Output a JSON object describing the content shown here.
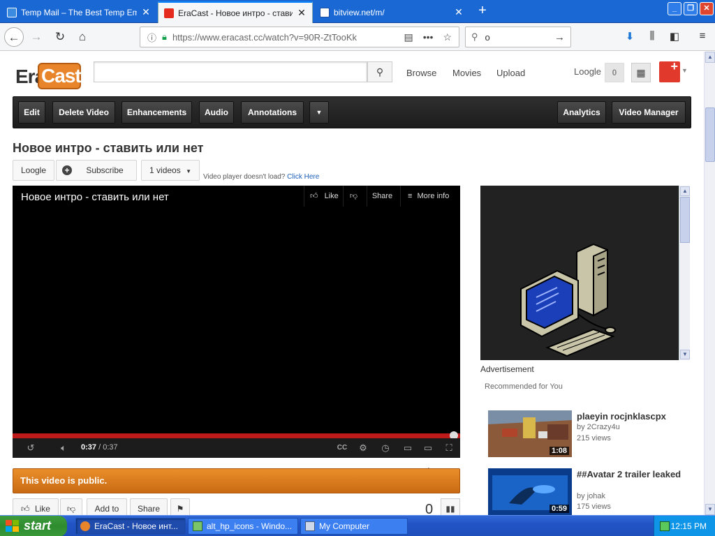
{
  "browser": {
    "tabs": [
      {
        "label": "Temp Mail – The Best Temp Email I",
        "active": false
      },
      {
        "label": "EraCast - Новое интро - ставить",
        "active": true
      },
      {
        "label": "bitview.net/m/",
        "active": false
      }
    ],
    "url": "https://www.eracast.cc/watch?v=90R-ZtTooKk",
    "search_text": "o"
  },
  "header": {
    "logo_era": "Era",
    "logo_cast": "Cast",
    "nav": [
      "Browse",
      "Movies",
      "Upload"
    ],
    "username": "Loogle",
    "notifications": "0"
  },
  "actionbar": {
    "left": [
      "Edit",
      "Delete Video",
      "Enhancements",
      "Audio",
      "Annotations"
    ],
    "right": [
      "Analytics",
      "Video Manager"
    ]
  },
  "video": {
    "title": "Новое интро - ставить или нет",
    "channel": "Loogle",
    "subscribe": "Subscribe",
    "videos_count": "1 videos",
    "load_msg": "Video player doesn't load?",
    "load_link": "Click Here",
    "player_actions": {
      "like": "Like",
      "share": "Share",
      "more": "More info"
    },
    "time_current": "0:37",
    "time_total": "/ 0:37",
    "progress": 1.0,
    "public_msg": "This video is public.",
    "bottom_buttons": {
      "like": "Like",
      "add": "Add to",
      "share": "Share"
    },
    "views": "0"
  },
  "sidebar": {
    "ad_label": "Advertisement",
    "recommended_label": "Recommended for You",
    "recommended": [
      {
        "title": "plaeyin rocjnklascpx",
        "by": "by 2Crazy4u",
        "views": "215 views",
        "duration": "1:08"
      },
      {
        "title": "##Avatar 2 trailer leaked",
        "by": "by johak",
        "views": "175 views",
        "duration": "0:59"
      }
    ]
  },
  "taskbar": {
    "start": "start",
    "tasks": [
      {
        "label": "EraCast - Новое инт...",
        "active": true
      },
      {
        "label": "alt_hp_icons - Windo...",
        "active": false
      },
      {
        "label": "My Computer",
        "active": false
      }
    ],
    "clock": "12:15 PM"
  }
}
